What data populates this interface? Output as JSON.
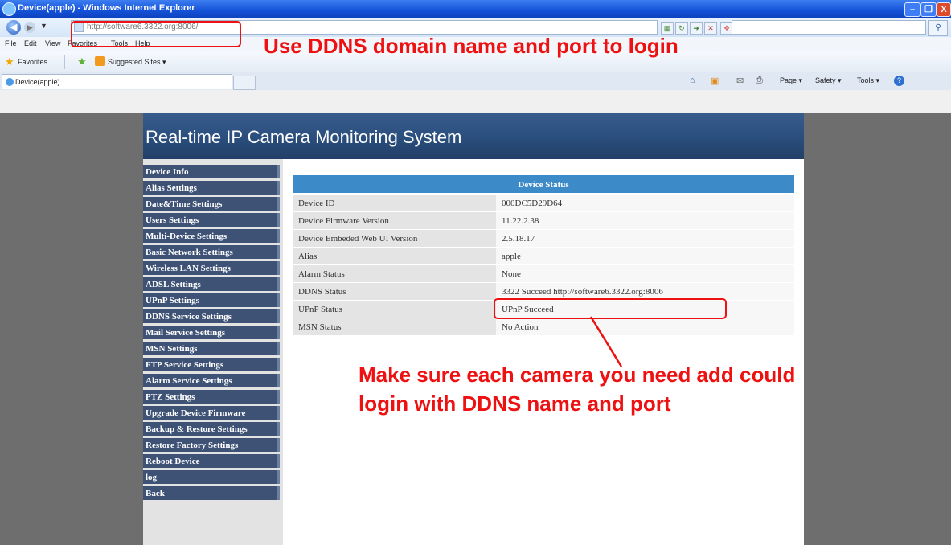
{
  "window": {
    "title": "Device(apple) - Windows Internet Explorer",
    "min_label": "–",
    "max_label": "❐",
    "close_label": "X"
  },
  "address": {
    "url": "http://software6.3322.org:8006/",
    "search_placeholder": ""
  },
  "menu": [
    "File",
    "Edit",
    "View",
    "Favorites",
    "Tools",
    "Help"
  ],
  "favorites": {
    "label": "Favorites",
    "suggested": "Suggested Sites ▾"
  },
  "tab": {
    "label": "Device(apple)"
  },
  "command_bar": [
    "Page ▾",
    "Safety ▾",
    "Tools ▾"
  ],
  "page": {
    "title": "Real-time IP Camera Monitoring System",
    "sidebar": [
      "Device Info",
      "Alias Settings",
      "Date&Time Settings",
      "Users Settings",
      "Multi-Device Settings",
      "Basic Network Settings",
      "Wireless LAN Settings",
      "ADSL Settings",
      "UPnP Settings",
      "DDNS Service Settings",
      "Mail Service Settings",
      "MSN Settings",
      "FTP Service Settings",
      "Alarm Service Settings",
      "PTZ Settings",
      "Upgrade Device Firmware",
      "Backup & Restore Settings",
      "Restore Factory Settings",
      "Reboot Device",
      "log",
      "Back"
    ],
    "status_header": "Device Status",
    "status_rows": [
      {
        "label": "Device ID",
        "value": "000DC5D29D64"
      },
      {
        "label": "Device Firmware Version",
        "value": "11.22.2.38"
      },
      {
        "label": "Device Embeded Web UI Version",
        "value": "2.5.18.17"
      },
      {
        "label": "Alias",
        "value": "apple"
      },
      {
        "label": "Alarm Status",
        "value": "None"
      },
      {
        "label": "DDNS Status",
        "value": "3322 Succeed  http://software6.3322.org:8006"
      },
      {
        "label": "UPnP Status",
        "value": "UPnP Succeed"
      },
      {
        "label": "MSN Status",
        "value": "No Action"
      }
    ]
  },
  "annotations": {
    "top": "Use DDNS domain name and port to login",
    "bottom": "Make sure each camera you need add could login with DDNS name and port"
  },
  "colors": {
    "annotation": "#e11111",
    "header_blue": "#2a4e7d",
    "sidebar_bg": "#3e5276",
    "status_head": "#3d8ac9"
  }
}
